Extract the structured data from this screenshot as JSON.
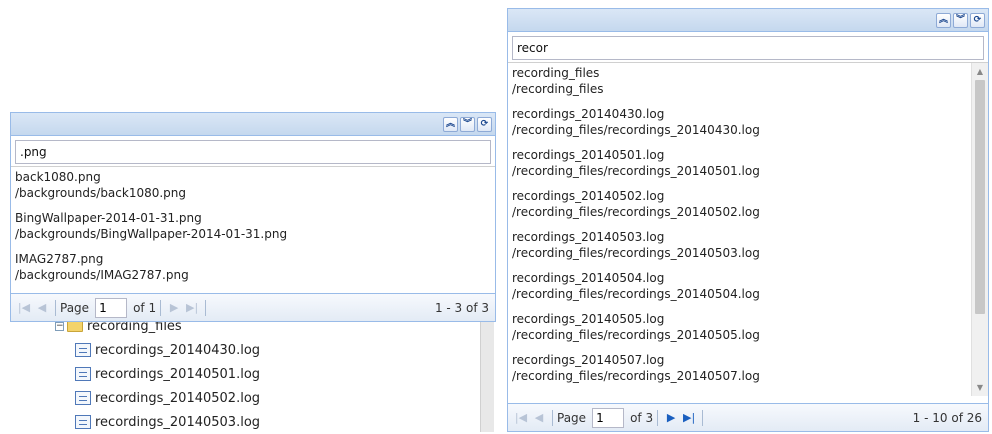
{
  "left_panel": {
    "search_value": ".png",
    "results": [
      {
        "name": "back1080.png",
        "path": "/backgrounds/back1080.png"
      },
      {
        "name": "BingWallpaper-2014-01-31.png",
        "path": "/backgrounds/BingWallpaper-2014-01-31.png"
      },
      {
        "name": "IMAG2787.png",
        "path": "/backgrounds/IMAG2787.png"
      }
    ],
    "pager": {
      "page_label": "Page",
      "page_value": "1",
      "of_label": "of 1",
      "range": "1 - 3 of 3"
    }
  },
  "right_panel": {
    "search_value": "recor",
    "results": [
      {
        "name": "recording_files",
        "path": "/recording_files"
      },
      {
        "name": "recordings_20140430.log",
        "path": "/recording_files/recordings_20140430.log"
      },
      {
        "name": "recordings_20140501.log",
        "path": "/recording_files/recordings_20140501.log"
      },
      {
        "name": "recordings_20140502.log",
        "path": "/recording_files/recordings_20140502.log"
      },
      {
        "name": "recordings_20140503.log",
        "path": "/recording_files/recordings_20140503.log"
      },
      {
        "name": "recordings_20140504.log",
        "path": "/recording_files/recordings_20140504.log"
      },
      {
        "name": "recordings_20140505.log",
        "path": "/recording_files/recordings_20140505.log"
      },
      {
        "name": "recordings_20140507.log",
        "path": "/recording_files/recordings_20140507.log"
      }
    ],
    "pager": {
      "page_label": "Page",
      "page_value": "1",
      "of_label": "of 3",
      "range": "1 - 10 of 26"
    }
  },
  "tree": {
    "folder": "recording_files",
    "files": [
      "recordings_20140430.log",
      "recordings_20140501.log",
      "recordings_20140502.log",
      "recordings_20140503.log"
    ]
  },
  "header_tools": [
    "collapse-up-icon",
    "collapse-down-icon",
    "refresh-icon"
  ],
  "colors": {
    "header": "#c5d8ee",
    "border": "#99bbe8",
    "active_pager": "#1a5fbf",
    "folder": "#f4d36a"
  }
}
